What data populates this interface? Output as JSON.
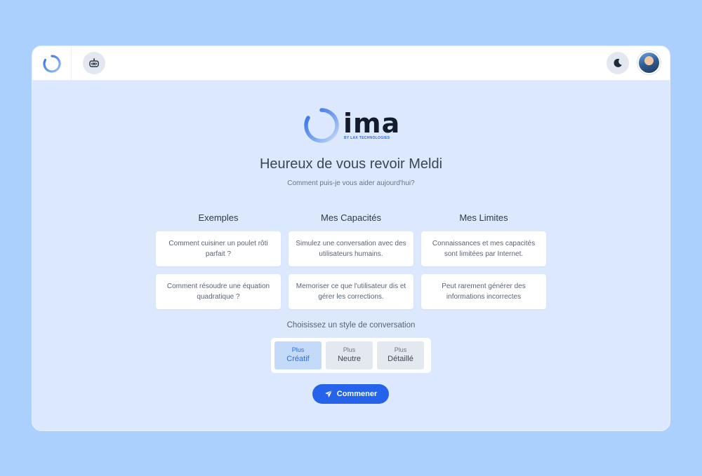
{
  "brand": {
    "name": "ima",
    "tagline": "BY LAX TECHNOLOGIES",
    "accent": "#2563eb"
  },
  "header": {
    "bot_icon": "robot-icon",
    "theme_icon": "moon-icon",
    "avatar_icon": "user-avatar"
  },
  "main": {
    "welcome": "Heureux de vous revoir Meldi",
    "subtitle": "Comment puis-je vous aider aujourd'hui?",
    "columns": [
      {
        "title": "Exemples",
        "cards": [
          "Comment cuisiner un poulet rôti parfait ?",
          "Comment résoudre une équation quadratique ?"
        ]
      },
      {
        "title": "Mes Capacités",
        "cards": [
          "Simulez une conversation avec des utilisateurs humains.",
          "Memoriser ce que l'utilisateur dis et gérer les corrections."
        ]
      },
      {
        "title": "Mes Limites",
        "cards": [
          "Connaissances et mes capacités sont limitées par Internet.",
          "Peut rarement générer des informations incorrectes"
        ]
      }
    ],
    "style_label": "Choisissez un style de conversation",
    "styles": [
      {
        "top": "Plus",
        "main": "Créatif",
        "selected": true
      },
      {
        "top": "Plus",
        "main": "Neutre",
        "selected": false
      },
      {
        "top": "Plus",
        "main": "Détaillé",
        "selected": false
      }
    ],
    "start_label": "Commener",
    "start_icon": "send-icon"
  }
}
